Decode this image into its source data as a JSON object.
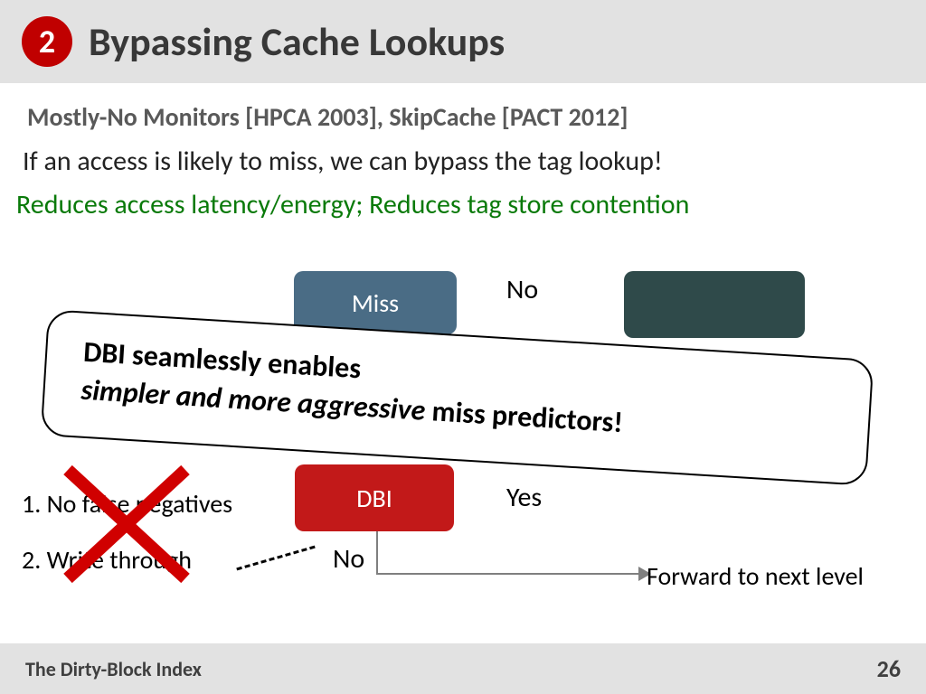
{
  "header": {
    "badge_number": "2",
    "title": "Bypassing Cache Lookups"
  },
  "subtitle": "Mostly-No Monitors [HPCA 2003], SkipCache [PACT 2012]",
  "body": {
    "line1": "If an access is likely to miss, we can bypass the tag lookup!",
    "line2": "Reduces access latency/energy; Reduces tag store contention"
  },
  "diagram": {
    "miss_box": "Miss",
    "dbi_box": "DBI",
    "no": "No",
    "yes": "Yes",
    "no2": "No",
    "forward": "Forward to next level"
  },
  "requirements": {
    "r1": "1. No false negatives",
    "r2": "2. Write through"
  },
  "callout": {
    "part1": "DBI seamlessly enables",
    "emph": "simpler and more aggressive",
    "part2": " miss predictors!"
  },
  "footer": {
    "left": "The Dirty-Block Index",
    "page": "26"
  }
}
